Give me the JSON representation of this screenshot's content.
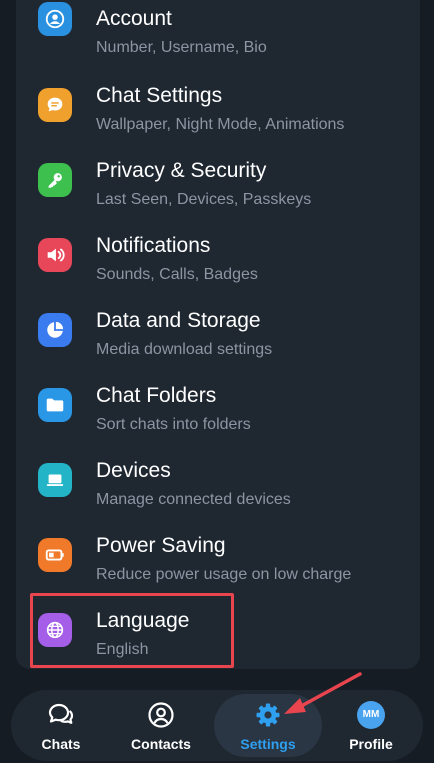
{
  "settings": {
    "items": [
      {
        "title": "Account",
        "subtitle": "Number, Username, Bio",
        "icon": "person-icon",
        "color": "#2a90e0"
      },
      {
        "title": "Chat Settings",
        "subtitle": "Wallpaper, Night Mode, Animations",
        "icon": "chat-bubble-icon",
        "color": "#f0a02c"
      },
      {
        "title": "Privacy & Security",
        "subtitle": "Last Seen, Devices, Passkeys",
        "icon": "key-icon",
        "color": "#3ec04e"
      },
      {
        "title": "Notifications",
        "subtitle": "Sounds, Calls, Badges",
        "icon": "speaker-icon",
        "color": "#e8475a"
      },
      {
        "title": "Data and Storage",
        "subtitle": "Media download settings",
        "icon": "pie-chart-icon",
        "color": "#3a7bf0"
      },
      {
        "title": "Chat Folders",
        "subtitle": "Sort chats into folders",
        "icon": "folder-icon",
        "color": "#2a97e6"
      },
      {
        "title": "Devices",
        "subtitle": "Manage connected devices",
        "icon": "laptop-icon",
        "color": "#23b5c7"
      },
      {
        "title": "Power Saving",
        "subtitle": "Reduce power usage on low charge",
        "icon": "battery-icon",
        "color": "#f17a2a"
      },
      {
        "title": "Language",
        "subtitle": "English",
        "icon": "globe-icon",
        "color": "#a45ee8"
      }
    ]
  },
  "bottom_nav": {
    "items": [
      {
        "label": "Chats",
        "icon": "chat-icon",
        "active": false
      },
      {
        "label": "Contacts",
        "icon": "contact-icon",
        "active": false
      },
      {
        "label": "Settings",
        "icon": "gear-icon",
        "active": true
      },
      {
        "label": "Profile",
        "icon": "avatar",
        "active": false
      }
    ],
    "avatar_initials": "MM",
    "active_color": "#2f9ff0"
  },
  "annotation": {
    "highlight_color": "#e8454f"
  }
}
